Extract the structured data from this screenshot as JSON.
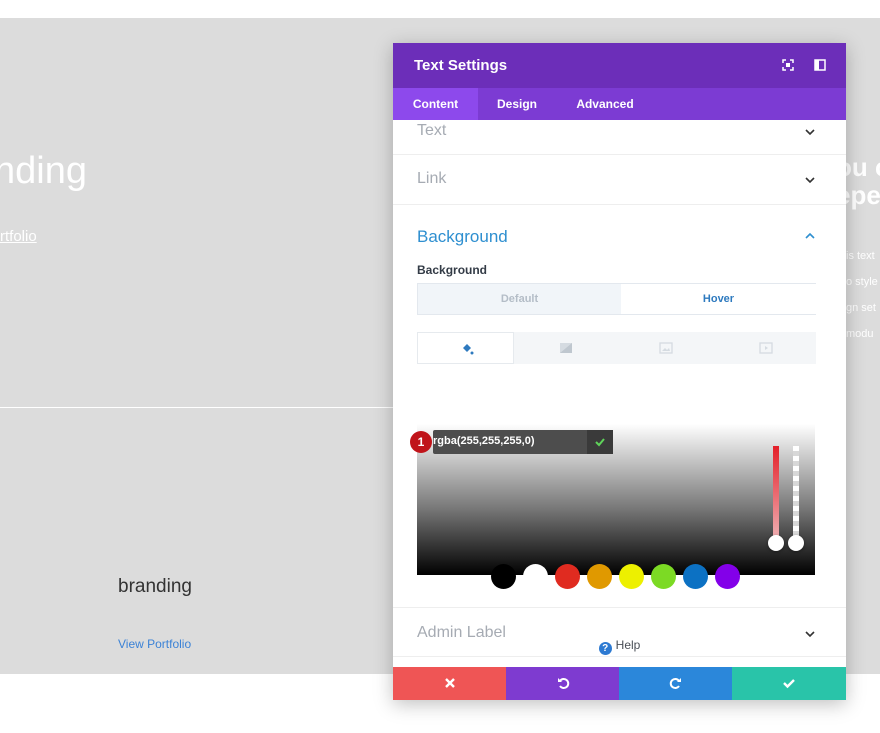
{
  "background": {
    "title": "nding",
    "link": "rtfolio",
    "branding": "branding",
    "view_portfolio": "View Portfolio",
    "right_heading_1": "ou c",
    "right_heading_2": "epe",
    "right_text": [
      "is text",
      "o style",
      "gn set",
      "modu"
    ]
  },
  "modal": {
    "title": "Text Settings",
    "header_icons": [
      "fullscreen-icon",
      "sidebar-icon"
    ],
    "tabs": [
      {
        "label": "Content",
        "active": true
      },
      {
        "label": "Design",
        "active": false
      },
      {
        "label": "Advanced",
        "active": false
      }
    ],
    "sections": {
      "text": "Text",
      "link": "Link",
      "background": "Background",
      "admin_label": "Admin Label"
    },
    "background_field": {
      "label": "Background",
      "toggle": {
        "default": "Default",
        "hover": "Hover",
        "selected": "Hover"
      },
      "icon_tabs": [
        "paint-bucket-icon",
        "gradient-icon",
        "image-icon",
        "video-icon"
      ]
    },
    "color_picker": {
      "value": "rgba(255,255,255,0)",
      "badge": "1",
      "swatches": [
        "#000000",
        "#ffffff",
        "#e02b20",
        "#e09900",
        "#edf000",
        "#7cda24",
        "#0c71c3",
        "#8300e9"
      ]
    },
    "help": "Help",
    "footer": [
      {
        "icon": "close-icon",
        "color": "#ef5555"
      },
      {
        "icon": "undo-icon",
        "color": "#7e3bd0"
      },
      {
        "icon": "redo-icon",
        "color": "#2b87da"
      },
      {
        "icon": "check-icon",
        "color": "#29c4a9"
      }
    ]
  }
}
